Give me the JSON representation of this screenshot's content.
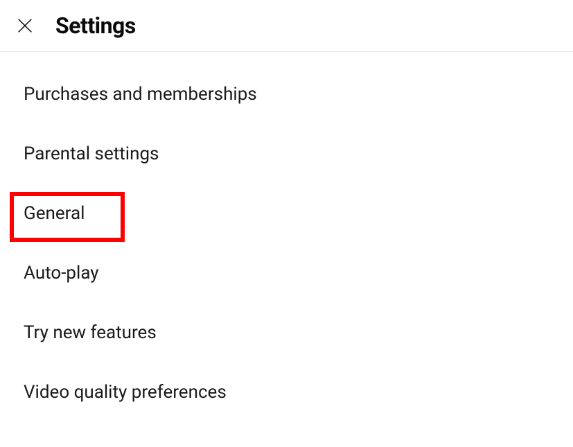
{
  "header": {
    "title": "Settings"
  },
  "settings": {
    "items": [
      {
        "label": "Purchases and memberships",
        "highlighted": false
      },
      {
        "label": "Parental settings",
        "highlighted": false
      },
      {
        "label": "General",
        "highlighted": true
      },
      {
        "label": "Auto-play",
        "highlighted": false
      },
      {
        "label": "Try new features",
        "highlighted": false
      },
      {
        "label": "Video quality preferences",
        "highlighted": false
      }
    ]
  },
  "colors": {
    "highlight": "#ff0000",
    "text": "#1a1a1a",
    "border": "#e5e5e5"
  }
}
